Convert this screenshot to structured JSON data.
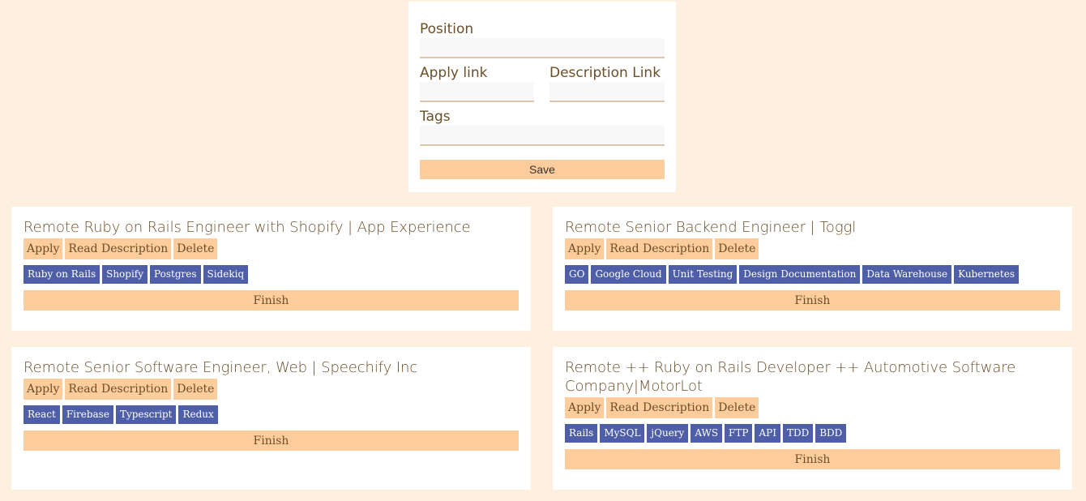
{
  "form": {
    "position_label": "Position",
    "position_value": "",
    "apply_link_label": "Apply link",
    "apply_link_value": "",
    "description_link_label": "Description Link",
    "description_link_value": "",
    "tags_label": "Tags",
    "tags_value": "",
    "save_label": "Save"
  },
  "jobs": [
    {
      "title": "Remote Ruby on Rails Engineer with Shopify | App Experience",
      "apply_label": "Apply",
      "read_label": "Read Description",
      "delete_label": "Delete",
      "tags": [
        "Ruby on Rails",
        "Shopify",
        "Postgres",
        "Sidekiq"
      ],
      "finish_label": "Finish"
    },
    {
      "title": "Remote Senior Backend Engineer | Toggl",
      "apply_label": "Apply",
      "read_label": "Read Description",
      "delete_label": "Delete",
      "tags": [
        "GO",
        "Google Cloud",
        "Unit Testing",
        "Design Documentation",
        "Data Warehouse",
        "Kubernetes"
      ],
      "finish_label": "Finish"
    },
    {
      "title": "Remote Senior Software Engineer, Web | Speechify Inc",
      "apply_label": "Apply",
      "read_label": "Read Description",
      "delete_label": "Delete",
      "tags": [
        "React",
        "Firebase",
        "Typescript",
        "Redux"
      ],
      "finish_label": "Finish"
    },
    {
      "title": "Remote ++ Ruby on Rails Developer ++ Automotive Software Company|MotorLot",
      "apply_label": "Apply",
      "read_label": "Read Description",
      "delete_label": "Delete",
      "tags": [
        "Rails",
        "MySQL",
        "jQuery",
        "AWS",
        "FTP",
        "API",
        "TDD",
        "BDD"
      ],
      "finish_label": "Finish"
    }
  ],
  "colors": {
    "background": "#fef0df",
    "card": "#ffffff",
    "accent": "#ffcc9b",
    "tag": "#4e5fa8",
    "text": "#6b4f2a"
  }
}
